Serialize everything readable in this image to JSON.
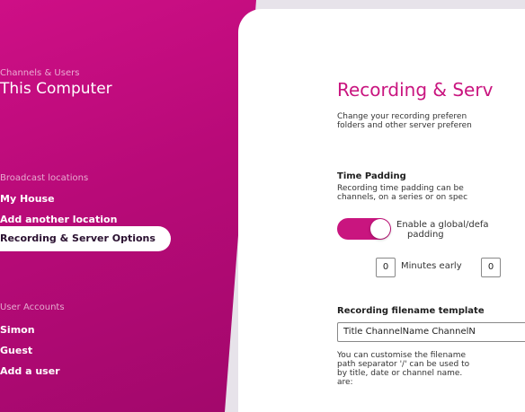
{
  "sidebar": {
    "section1_label": "Channels & Users",
    "section1_title": "This Computer",
    "section2_label": "Broadcast locations",
    "location_1": "My House",
    "add_location": "Add another location",
    "active_item": "Recording & Server Options",
    "section3_label": "User Accounts",
    "user_1": "Simon",
    "user_2": "Guest",
    "add_user": "Add a user"
  },
  "panel": {
    "title": "Recording & Serv",
    "intro_line1": "Change your recording preferen",
    "intro_line2": "folders and other server preferen",
    "time_padding_heading": "Time Padding",
    "time_padding_line1": "Recording time padding can be",
    "time_padding_line2": "channels, on a series or on spec",
    "toggle_label_line1": "Enable a global/defa",
    "toggle_label_line2": "padding",
    "minutes_early_value": "0",
    "minutes_early_label": "Minutes early",
    "minutes_late_value": "0",
    "filename_heading": "Recording filename template",
    "filename_template_value": "Title ChannelName ChannelN",
    "filename_help_line1": "You can customise the filename",
    "filename_help_line2": "path separator '/' can be used to",
    "filename_help_line3": "by title, date or channel name.",
    "filename_help_line4": "are:"
  },
  "colors": {
    "accent": "#c9157f",
    "sidebar": "#b80a78"
  }
}
